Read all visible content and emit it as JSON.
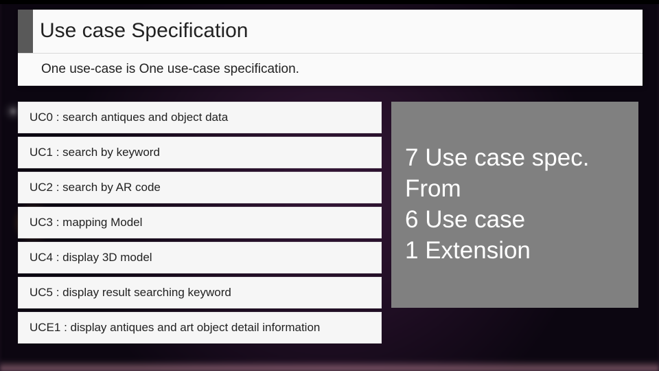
{
  "title": "Use case Specification",
  "subtitle": "One use-case is One use-case specification.",
  "items": [
    "UC0 : search antiques and object data",
    "UC1 : search by keyword",
    "UC2 : search by AR code",
    "UC3 : mapping Model",
    "UC4 : display 3D model",
    "UC5 : display result searching keyword",
    "UCE1 : display antiques and art object detail information"
  ],
  "summary": {
    "line1": "7 Use case spec.",
    "line2": "From",
    "line3": "6 Use case",
    "line4": "1 Extension"
  },
  "colors": {
    "accent": "#595959",
    "summary_bg": "#808080",
    "card_bg": "#fafafa",
    "item_bg": "#f6f6f6"
  }
}
